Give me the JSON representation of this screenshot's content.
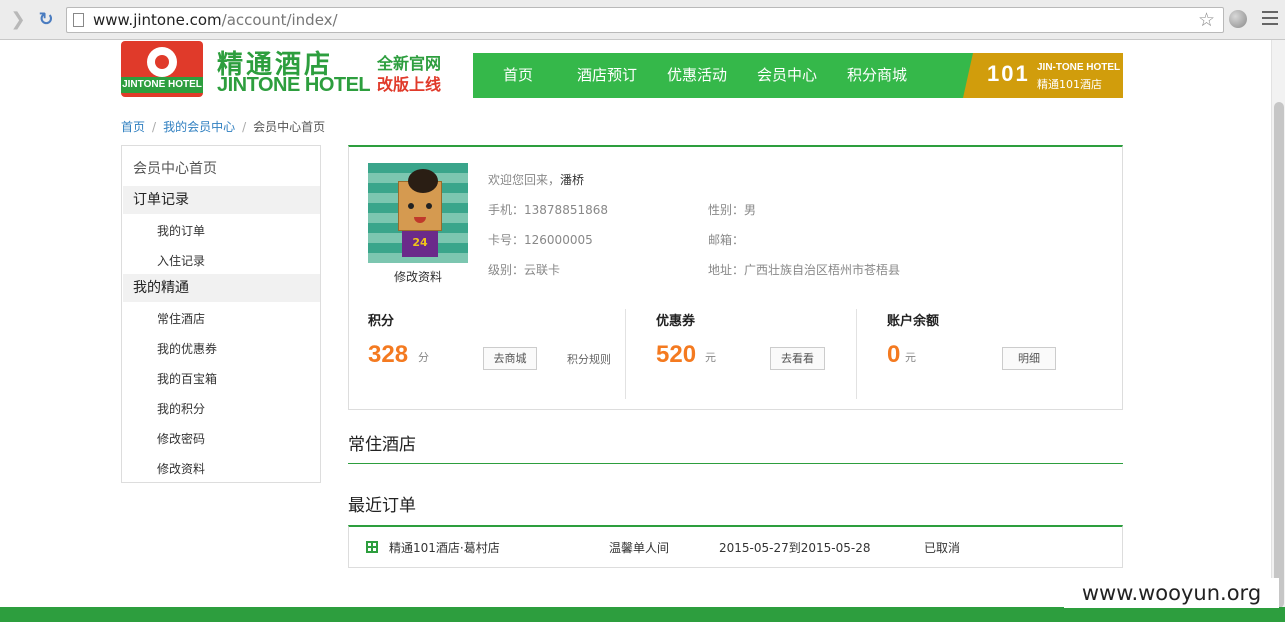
{
  "browser": {
    "url_host": "www.jintone.com",
    "url_path": "/account/index/"
  },
  "header": {
    "logo_text": "JINTONE HOTEL",
    "brand_cn": "精通酒店",
    "brand_en": "JINTONE HOTEL",
    "slogan_line1": "全新官网",
    "slogan_line2": "改版上线",
    "nav": [
      "首页",
      "酒店预订",
      "优惠活动",
      "会员中心",
      "积分商城"
    ],
    "banner_mark": "101",
    "banner_en": "JIN-TONE HOTEL",
    "banner_cn": "精通101酒店"
  },
  "breadcrumb": [
    "首页",
    "我的会员中心",
    "会员中心首页"
  ],
  "sidebar": {
    "title": "会员中心首页",
    "group1": "订单记录",
    "group1_items": [
      "我的订单",
      "入住记录"
    ],
    "group2": "我的精通",
    "group2_items": [
      "常住酒店",
      "我的优惠券",
      "我的百宝箱",
      "我的积分",
      "修改密码",
      "修改资料"
    ]
  },
  "profile": {
    "avatar_number": "24",
    "edit_label": "修改资料",
    "welcome_label": "欢迎您回来，",
    "name": "潘桥",
    "phone_label": "手机：",
    "phone": "13878851868",
    "gender_label": "性别：",
    "gender": "男",
    "card_label": "卡号：",
    "card": "126000005",
    "email_label": "邮箱：",
    "email": "",
    "level_label": "级别：",
    "level": "云联卡",
    "address_label": "地址：",
    "address": "广西壮族自治区梧州市苍梧县"
  },
  "stats": {
    "points_title": "积分",
    "points_value": "328",
    "points_unit": "分",
    "points_button": "去商城",
    "points_rules": "积分规则",
    "coupon_title": "优惠券",
    "coupon_value": "520",
    "coupon_unit": "元",
    "coupon_button": "去看看",
    "balance_title": "账户余额",
    "balance_value": "0",
    "balance_unit": "元",
    "balance_button": "明细"
  },
  "sections": {
    "frequent_hotels": "常住酒店",
    "recent_orders": "最近订单"
  },
  "orders": [
    {
      "hotel": "精通101酒店·葛村店",
      "room": "温馨单人间",
      "dates": "2015-05-27到2015-05-28",
      "status": "已取消"
    }
  ],
  "watermark": "www.wooyun.org",
  "colors": {
    "brand_green": "#2d9e3e",
    "nav_green": "#35b84a",
    "accent_orange": "#f47a20",
    "logo_red": "#e03a2a",
    "banner_gold": "#d19d0c"
  }
}
